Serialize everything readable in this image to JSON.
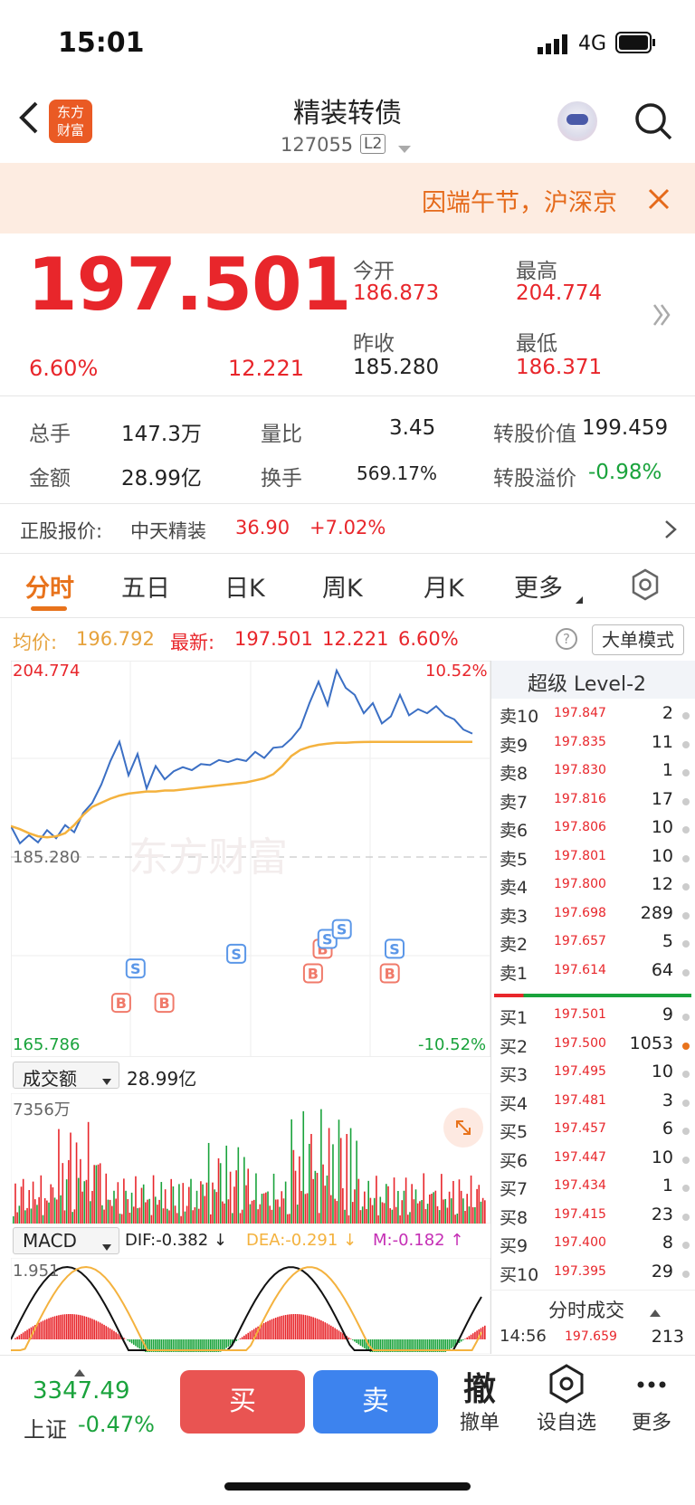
{
  "status": {
    "time": "15:01",
    "network": "4G"
  },
  "header": {
    "title": "精装转债",
    "code": "127055",
    "level": "L2",
    "logo_text": "东方财富"
  },
  "notice": {
    "text": "因端午节，沪深京"
  },
  "quote": {
    "price": "197.501",
    "change_pct": "6.60%",
    "change": "12.221",
    "open_label": "今开",
    "open": "186.873",
    "high_label": "最高",
    "high": "204.774",
    "prev_label": "昨收",
    "prev": "185.280",
    "low_label": "最低",
    "low": "186.371"
  },
  "stats": [
    {
      "label": "总手",
      "value": "147.3万"
    },
    {
      "label": "量比",
      "value": "3.45"
    },
    {
      "label": "转股价值",
      "value": "199.459"
    },
    {
      "label": "金额",
      "value": "28.99亿"
    },
    {
      "label": "换手",
      "value": "569.17%"
    },
    {
      "label": "转股溢价",
      "value": "-0.98%"
    }
  ],
  "stock": {
    "label": "正股报价:",
    "name": "中天精装",
    "price": "36.90",
    "change": "+7.02%"
  },
  "tabs": [
    "分时",
    "五日",
    "日K",
    "周K",
    "月K",
    "更多"
  ],
  "chart_info": {
    "avg_label": "均价:",
    "avg": "196.792",
    "latest_label": "最新:",
    "latest": "197.501",
    "change": "12.221",
    "pct": "6.60%",
    "mode_btn": "大单模式"
  },
  "chart_data": {
    "type": "line",
    "ytop": "204.774",
    "ybottom": "165.786",
    "ymid": "185.280",
    "pct_top": "10.52%",
    "pct_bottom": "-10.52%",
    "ylim": [
      165.786,
      204.774
    ],
    "series": [
      {
        "values": [
          188.5,
          186.8,
          187.6,
          186.9,
          188.1,
          187.3,
          188.6,
          187.9,
          189.8,
          190.8,
          192.6,
          194.9,
          196.8,
          193.5,
          195.6,
          192.2,
          194.4,
          193.1,
          193.9,
          194.3,
          194.0,
          194.6,
          194.5,
          195.0,
          194.8,
          195.1,
          194.9,
          195.8,
          195.2,
          196.2,
          196.3,
          197.1,
          198.2,
          200.6,
          202.7,
          200.4,
          203.8,
          202.1,
          201.4,
          199.6,
          200.6,
          198.6,
          199.3,
          201.4,
          199.4,
          200.0,
          199.6,
          200.3,
          199.4,
          199.0,
          198.0,
          197.6
        ]
      },
      {
        "values": [
          188.5,
          188.2,
          187.8,
          187.5,
          187.4,
          187.5,
          187.8,
          188.6,
          189.6,
          190.4,
          190.8,
          191.2,
          191.5,
          191.7,
          191.8,
          191.9,
          191.9,
          192.0,
          192.0,
          192.1,
          192.2,
          192.3,
          192.4,
          192.5,
          192.6,
          192.7,
          192.8,
          193.0,
          193.2,
          193.6,
          194.4,
          195.4,
          196.0,
          196.3,
          196.5,
          196.6,
          196.7,
          196.7,
          196.75,
          196.77,
          196.78,
          196.79,
          196.79,
          196.79,
          196.79,
          196.79,
          196.79,
          196.79,
          196.79,
          196.79,
          196.79,
          196.79
        ]
      }
    ],
    "markers": [
      "S",
      "B",
      "B",
      "S",
      "B",
      "B",
      "S",
      "S",
      "B",
      "S"
    ]
  },
  "level2": {
    "title": "超级 Level-2",
    "sells": [
      {
        "n": "卖10",
        "p": "197.847",
        "v": "2"
      },
      {
        "n": "卖9",
        "p": "197.835",
        "v": "11"
      },
      {
        "n": "卖8",
        "p": "197.830",
        "v": "1"
      },
      {
        "n": "卖7",
        "p": "197.816",
        "v": "17"
      },
      {
        "n": "卖6",
        "p": "197.806",
        "v": "10"
      },
      {
        "n": "卖5",
        "p": "197.801",
        "v": "10"
      },
      {
        "n": "卖4",
        "p": "197.800",
        "v": "12"
      },
      {
        "n": "卖3",
        "p": "197.698",
        "v": "289"
      },
      {
        "n": "卖2",
        "p": "197.657",
        "v": "5"
      },
      {
        "n": "卖1",
        "p": "197.614",
        "v": "64"
      }
    ],
    "buys": [
      {
        "n": "买1",
        "p": "197.501",
        "v": "9"
      },
      {
        "n": "买2",
        "p": "197.500",
        "v": "1053"
      },
      {
        "n": "买3",
        "p": "197.495",
        "v": "10"
      },
      {
        "n": "买4",
        "p": "197.481",
        "v": "3"
      },
      {
        "n": "买5",
        "p": "197.457",
        "v": "6"
      },
      {
        "n": "买6",
        "p": "197.447",
        "v": "10"
      },
      {
        "n": "买7",
        "p": "197.434",
        "v": "1"
      },
      {
        "n": "买8",
        "p": "197.415",
        "v": "23"
      },
      {
        "n": "买9",
        "p": "197.400",
        "v": "8"
      },
      {
        "n": "买10",
        "p": "197.395",
        "v": "29"
      }
    ],
    "trades_title": "分时成交",
    "trade": {
      "t": "14:56",
      "p": "197.659",
      "v": "213"
    }
  },
  "volume": {
    "label": "成交额",
    "total": "28.99亿",
    "max": "7356万"
  },
  "macd": {
    "label": "MACD",
    "dif": "DIF:-0.382 ↓",
    "dea": "DEA:-0.291 ↓",
    "m": "M:-0.182 ↑",
    "top": "1.951"
  },
  "bottom": {
    "index_value": "3347.49",
    "index_name": "上证",
    "index_pct": "-0.47%",
    "buy": "买",
    "sell": "卖",
    "cancel": "撤单",
    "cancel_icon": "撤",
    "fav": "设自选",
    "more": "更多"
  },
  "colors": {
    "up": "#e8262b",
    "down": "#1aa33c",
    "avg": "#f4b23e",
    "price": "#3b6fc4",
    "accent": "#e8731c"
  }
}
